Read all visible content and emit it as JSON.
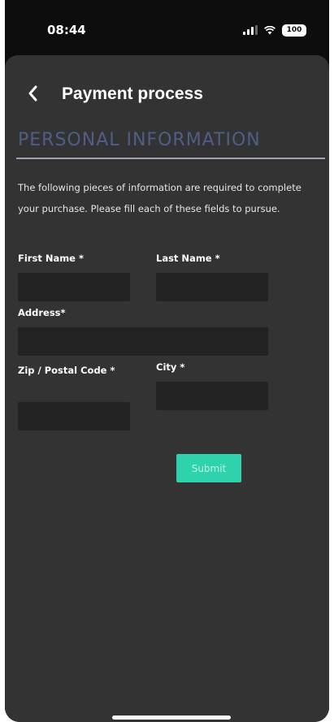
{
  "status_bar": {
    "time": "08:44",
    "battery": "100"
  },
  "header": {
    "title": "Payment process"
  },
  "section": {
    "title": "PERSONAL INFORMATION",
    "intro": "The following pieces of information are required to complete your purchase. Please fill each of these fields to pursue."
  },
  "form": {
    "first_name": {
      "label": "First Name *",
      "value": ""
    },
    "last_name": {
      "label": "Last Name *",
      "value": ""
    },
    "address": {
      "label": "Address*",
      "value": ""
    },
    "zip": {
      "label": "Zip / Postal Code *",
      "value": ""
    },
    "city": {
      "label": "City *",
      "value": ""
    },
    "submit_label": "Submit"
  },
  "colors": {
    "sheet_bg": "#333333",
    "field_bg": "#222222",
    "section_title": "#4f5e86",
    "accent": "#2ed3ad"
  }
}
